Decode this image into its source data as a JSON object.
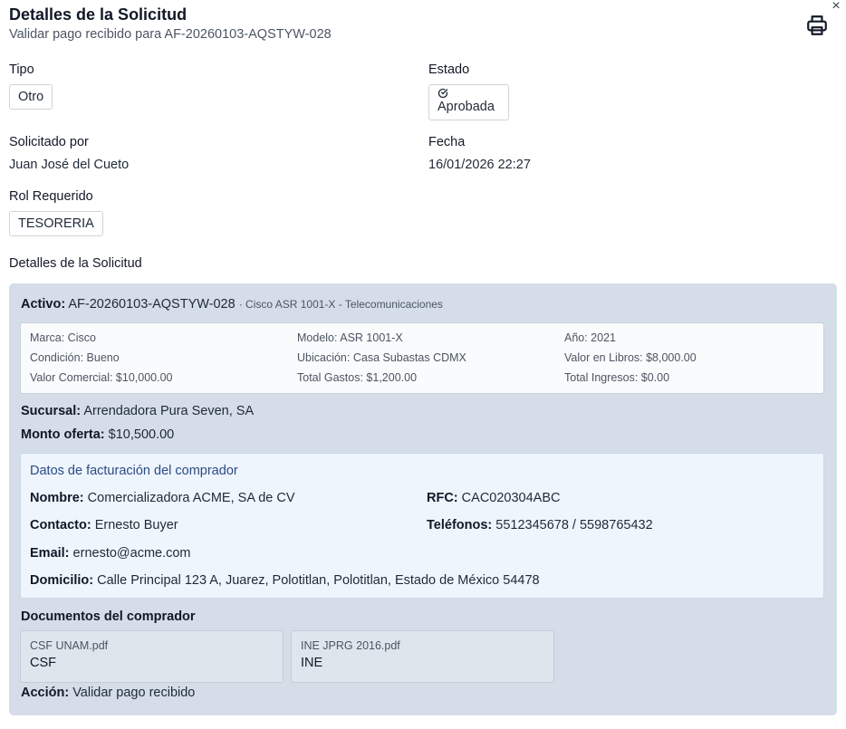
{
  "header": {
    "title": "Detalles de la Solicitud",
    "subtitle": "Validar pago recibido para AF-20260103-AQSTYW-028",
    "close_glyph": "×"
  },
  "icons": {
    "close": "close-icon",
    "print": "printer-icon",
    "status": "check-circle-icon"
  },
  "fields": {
    "tipo_label": "Tipo",
    "tipo_value": "Otro",
    "estado_label": "Estado",
    "estado_value": "Aprobada",
    "solicitado_label": "Solicitado por",
    "solicitado_value": "Juan José del Cueto",
    "fecha_label": "Fecha",
    "fecha_value": "16/01/2026 22:27",
    "rol_label": "Rol Requerido",
    "rol_value": "TESORERIA"
  },
  "details": {
    "section_label": "Detalles de la Solicitud",
    "activo_label": "Activo:",
    "activo_id": "AF-20260103-AQSTYW-028",
    "activo_desc": "· Cisco ASR 1001-X - Telecomunicaciones",
    "specs": [
      [
        "Marca: Cisco",
        "Modelo: ASR 1001-X",
        "Año: 2021"
      ],
      [
        "Condición: Bueno",
        "Ubicación: Casa Subastas CDMX",
        "Valor en Libros: $8,000.00"
      ],
      [
        "Valor Comercial: $10,000.00",
        "Total Gastos: $1,200.00",
        "Total Ingresos: $0.00"
      ]
    ],
    "sucursal_label": "Sucursal:",
    "sucursal_value": "Arrendadora Pura Seven, SA",
    "monto_label": "Monto oferta:",
    "monto_value": "$10,500.00",
    "billing": {
      "title": "Datos de facturación del comprador",
      "nombre_label": "Nombre:",
      "nombre_value": "Comercializadora ACME, SA de CV",
      "rfc_label": "RFC:",
      "rfc_value": "CAC020304ABC",
      "contacto_label": "Contacto:",
      "contacto_value": "Ernesto Buyer",
      "telefonos_label": "Teléfonos:",
      "telefonos_value": "5512345678 / 5598765432",
      "email_label": "Email:",
      "email_value": "ernesto@acme.com",
      "domicilio_label": "Domicilio:",
      "domicilio_value": "Calle Principal 123 A, Juarez, Polotitlan, Polotitlan, Estado de México 54478"
    },
    "docs_label": "Documentos del comprador",
    "documents": [
      {
        "file": "CSF UNAM.pdf",
        "type": "CSF"
      },
      {
        "file": "INE JPRG 2016.pdf",
        "type": "INE"
      }
    ],
    "accion_label": "Acción:",
    "accion_value": "Validar pago recibido"
  }
}
